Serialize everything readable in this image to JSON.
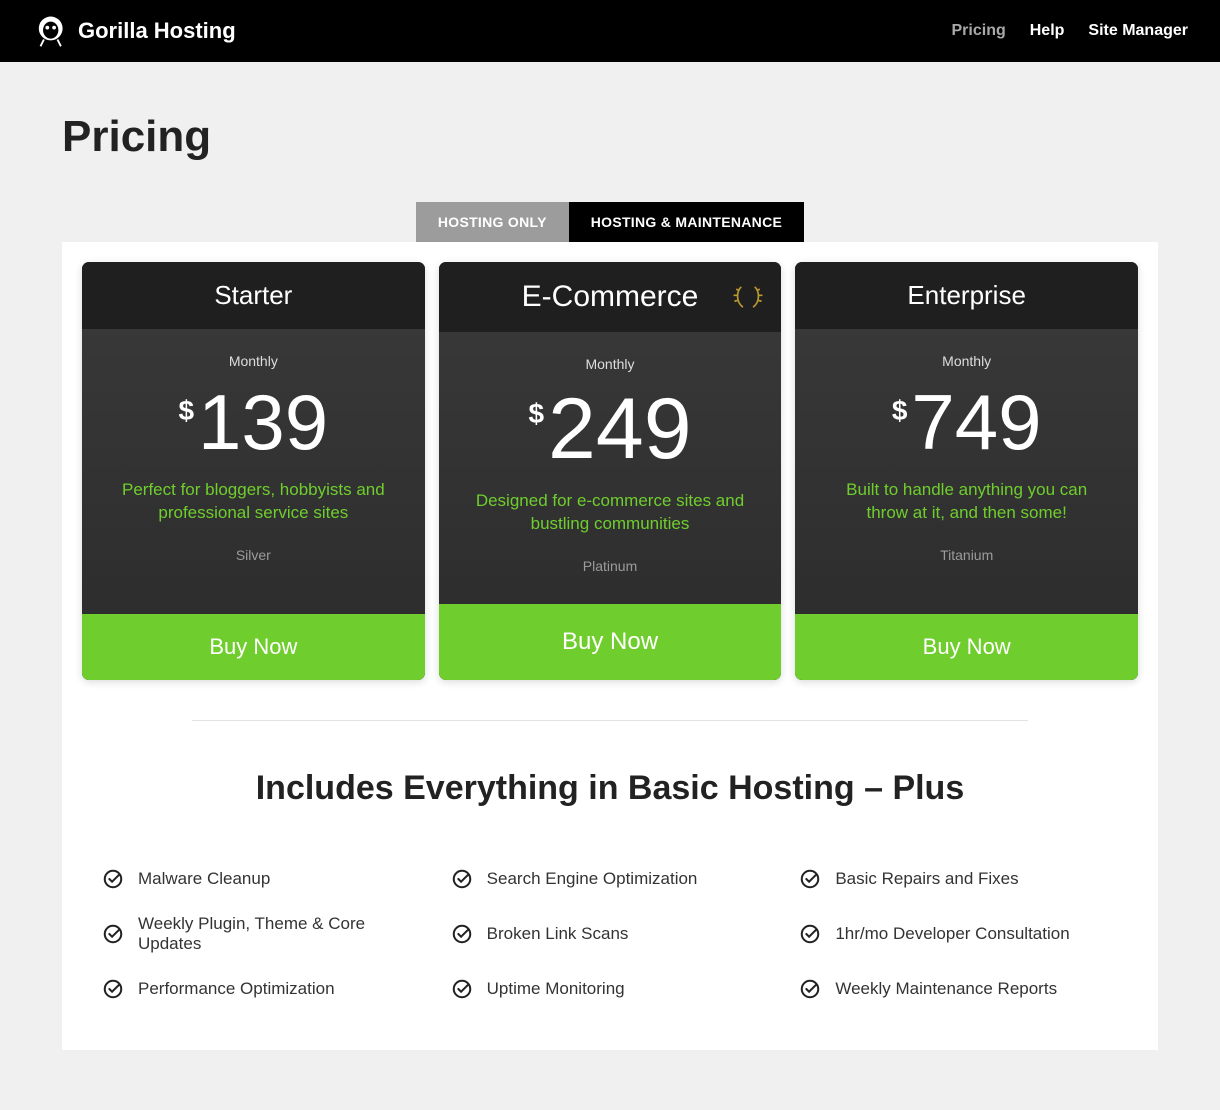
{
  "brand": "Gorilla Hosting",
  "nav": {
    "items": [
      {
        "label": "Pricing",
        "active": true
      },
      {
        "label": "Help",
        "active": false
      },
      {
        "label": "Site Manager",
        "active": false
      }
    ]
  },
  "page_title": "Pricing",
  "tabs": {
    "items": [
      {
        "label": "HOSTING ONLY",
        "active": false
      },
      {
        "label": "HOSTING & MAINTENANCE",
        "active": true
      }
    ]
  },
  "plans": [
    {
      "name": "Starter",
      "period": "Monthly",
      "currency": "$",
      "price": "139",
      "desc": "Perfect for bloggers, hobbyists and professional service sites",
      "tier": "Silver",
      "cta": "Buy Now",
      "featured": false
    },
    {
      "name": "E-Commerce",
      "period": "Monthly",
      "currency": "$",
      "price": "249",
      "desc": "Designed for e-commerce sites and bustling communities",
      "tier": "Platinum",
      "cta": "Buy Now",
      "featured": true
    },
    {
      "name": "Enterprise",
      "period": "Monthly",
      "currency": "$",
      "price": "749",
      "desc": "Built to handle anything you can throw at it, and then some!",
      "tier": "Titanium",
      "cta": "Buy Now",
      "featured": false
    }
  ],
  "includes_title": "Includes Everything in Basic Hosting – Plus",
  "features": [
    "Malware Cleanup",
    "Search Engine Optimization",
    "Basic Repairs and Fixes",
    "Weekly Plugin, Theme & Core Updates",
    "Broken Link Scans",
    "1hr/mo Developer Consultation",
    "Performance Optimization",
    "Uptime Monitoring",
    "Weekly Maintenance Reports"
  ],
  "colors": {
    "accent": "#6fce2d"
  }
}
